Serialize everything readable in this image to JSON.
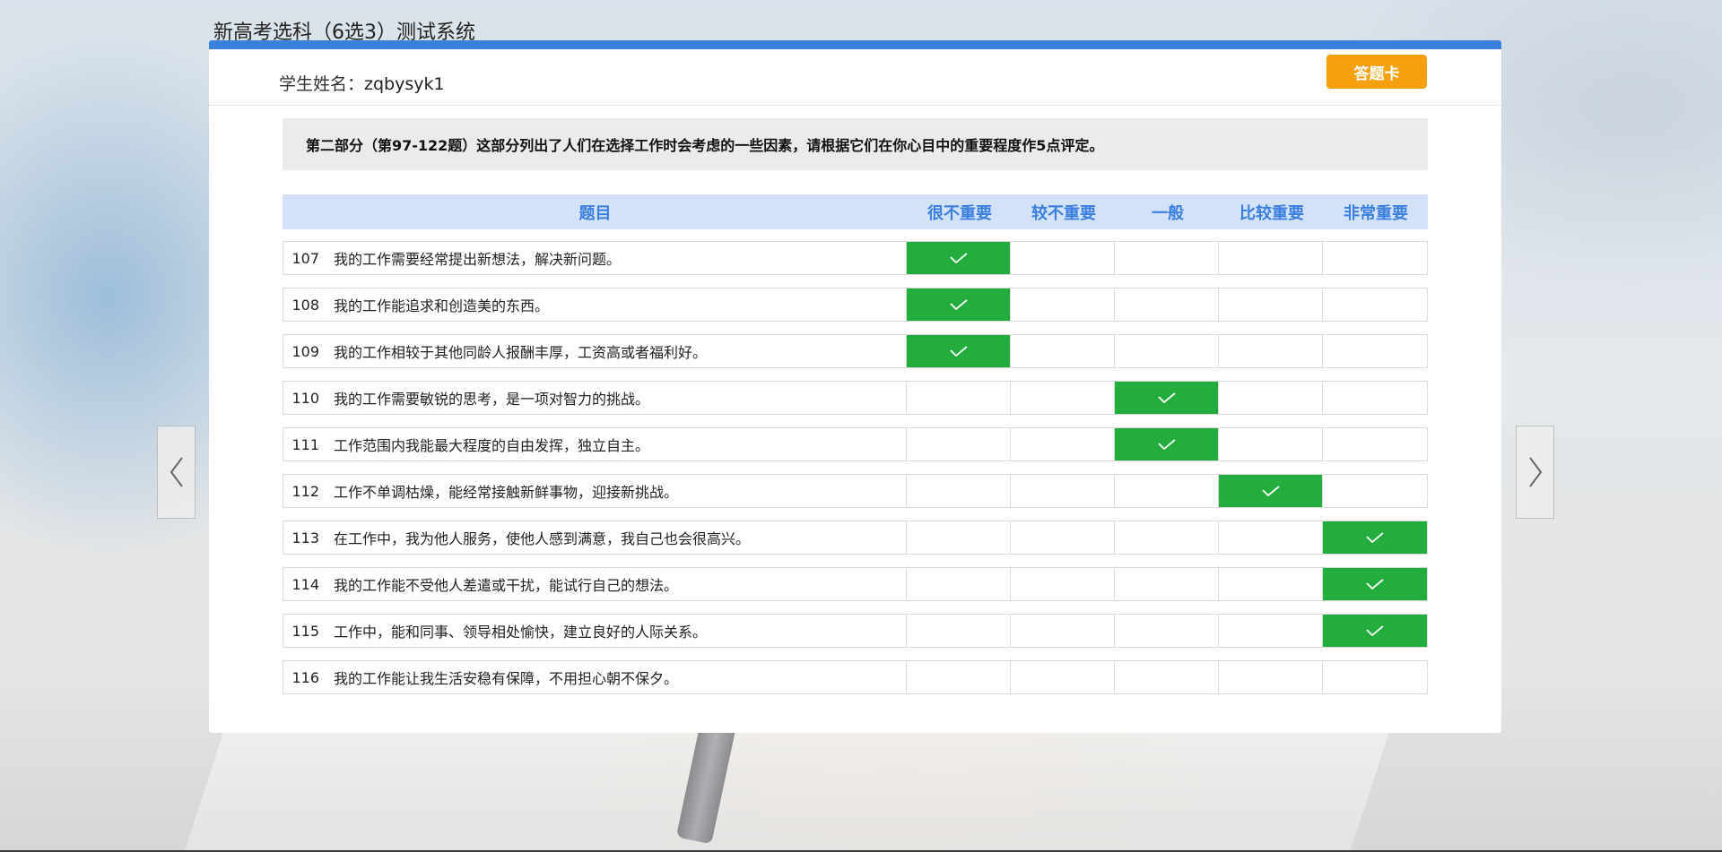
{
  "app": {
    "title": "新高考选科（6选3）测试系统"
  },
  "header": {
    "student_label": "学生姓名：",
    "student_name": "zqbysyk1",
    "answer_card_button": "答题卡"
  },
  "instruction": "第二部分（第97-122题）这部分列出了人们在选择工作时会考虑的一些因素，请根据它们在你心目中的重要程度作5点评定。",
  "table": {
    "question_header": "题目",
    "options": [
      "很不重要",
      "较不重要",
      "一般",
      "比较重要",
      "非常重要"
    ],
    "rows": [
      {
        "num": "107",
        "text": "我的工作需要经常提出新想法，解决新问题。",
        "selected": 0
      },
      {
        "num": "108",
        "text": "我的工作能追求和创造美的东西。",
        "selected": 0
      },
      {
        "num": "109",
        "text": "我的工作相较于其他同龄人报酬丰厚，工资高或者福利好。",
        "selected": 0
      },
      {
        "num": "110",
        "text": "我的工作需要敏锐的思考，是一项对智力的挑战。",
        "selected": 2
      },
      {
        "num": "111",
        "text": "工作范围内我能最大程度的自由发挥，独立自主。",
        "selected": 2
      },
      {
        "num": "112",
        "text": "工作不单调枯燥，能经常接触新鲜事物，迎接新挑战。",
        "selected": 3
      },
      {
        "num": "113",
        "text": "在工作中，我为他人服务，使他人感到满意，我自己也会很高兴。",
        "selected": 4
      },
      {
        "num": "114",
        "text": "我的工作能不受他人差遣或干扰，能试行自己的想法。",
        "selected": 4
      },
      {
        "num": "115",
        "text": "工作中，能和同事、领导相处愉快，建立良好的人际关系。",
        "selected": 4
      },
      {
        "num": "116",
        "text": "我的工作能让我生活安稳有保障，不用担心朝不保夕。",
        "selected": null
      }
    ]
  },
  "icons": {
    "prev": "chevron-left-icon",
    "next": "chevron-right-icon",
    "check": "check-icon"
  },
  "colors": {
    "accent_blue": "#3a80dd",
    "answer_card_orange": "#f5a00e",
    "selected_green": "#22ad3c",
    "header_bg": "#d3e2f8"
  }
}
